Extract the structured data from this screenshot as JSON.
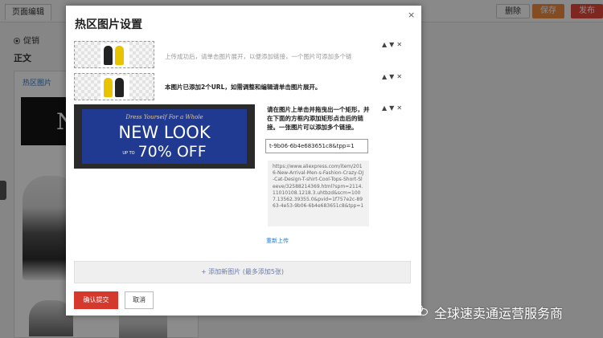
{
  "background": {
    "tab_label": "页面编辑",
    "buttons": {
      "delete": "删除",
      "save": "保存",
      "publish": "发布"
    },
    "radio_label": "促销",
    "section_title": "正文",
    "panel_tab": "热区图片",
    "banner_text": "N"
  },
  "modal": {
    "title": "热区图片设置",
    "close": "×",
    "rows": [
      {
        "text": "上传成功后，请单击图片展开，以便添加链接，一个图片可添加多个链",
        "icons": [
          "▲",
          "▼",
          "✕"
        ]
      },
      {
        "text": "本图片已添加2个URL，如需调整和编辑请单击图片展开。",
        "icons": [
          "▲",
          "▼",
          "✕"
        ]
      },
      {
        "icons": [
          "▲",
          "▼",
          "✕"
        ]
      }
    ],
    "expanded": {
      "banner": {
        "tagline": "Dress Yourself For a Whole",
        "title": "NEW LOOK",
        "up_to": "UP TO",
        "off": "70% OFF"
      },
      "description": "请在图片上单击并拖曳出一个矩形，并在下面的方框内添加矩形点击后的链接。一张图片可以添加多个链接。",
      "url_input_value": "t-9b06-6b4e683651c8&tpp=1",
      "url_list": "https://www.aliexpress.com/item/2016-New-Arrival-Men-s-Fashion-Crazy-DJ-Cat-Design-T-shirt-Cool-Tops-Short-Sleeve/32588214369.html?spm=2114.11010108.1218.3.uhtbzd&scm=1007.13562.39355.0&pvid=1f757e2c-8963-4e53-9b06-6b4e683651c8&tpp=1",
      "reupload": "重新上传"
    },
    "add_image": "+ 添加新图片 (最多添加5张)",
    "confirm": "确认提交",
    "cancel": "取消"
  },
  "watermark": {
    "text": "全球速卖通运营服务商"
  },
  "colors": {
    "primary_red": "#d5392c",
    "link_blue": "#2a7ccf",
    "banner_blue": "#1f3a90",
    "save_orange": "#f08a3e"
  }
}
